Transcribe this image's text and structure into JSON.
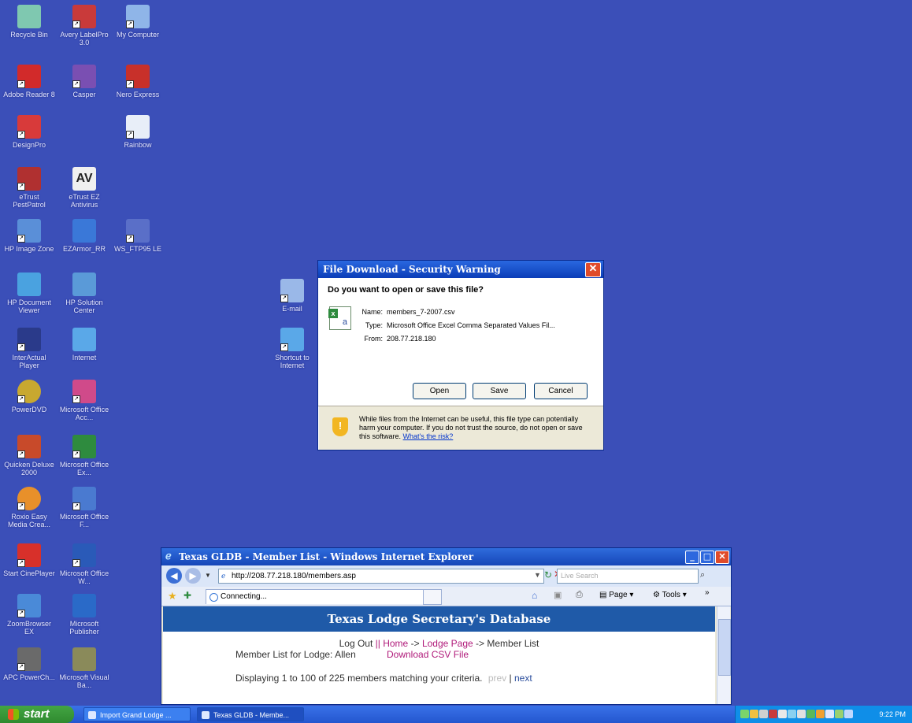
{
  "desktop": {
    "icons": [
      {
        "label": "Recycle Bin",
        "color": "#7fc8b0"
      },
      {
        "label": "Avery LabelPro 3.0",
        "color": "#c93a3a"
      },
      {
        "label": "My Computer",
        "color": "#8fb5e8"
      },
      {
        "label": "Adobe Reader 8",
        "color": "#d22a2a"
      },
      {
        "label": "Casper",
        "color": "#7a4fb2"
      },
      {
        "label": "Nero Express",
        "color": "#c8302a"
      },
      {
        "label": "DesignPro",
        "color": "#d83a3a"
      },
      {
        "label": "Rainbow",
        "color": "#e8eef8"
      },
      {
        "label": "eTrust PestPatrol",
        "color": "#b03030"
      },
      {
        "label": "eTrust EZ Antivirus",
        "color": "#f0f0f0"
      },
      {
        "label": "HP Image Zone",
        "color": "#5a8fd8"
      },
      {
        "label": "EZArmor_RR",
        "color": "#3a78d8"
      },
      {
        "label": "WS_FTP95 LE",
        "color": "#5a6fc8"
      },
      {
        "label": "HP Document Viewer",
        "color": "#4aa2e0"
      },
      {
        "label": "HP Solution Center",
        "color": "#5a9ad8"
      },
      {
        "label": "E-mail",
        "color": "#9ab8e8"
      },
      {
        "label": "InterActual Player",
        "color": "#2a3a8a"
      },
      {
        "label": "Internet",
        "color": "#5aa8e8"
      },
      {
        "label": "Shortcut to Internet",
        "color": "#5aa8e8"
      },
      {
        "label": "PowerDVD",
        "color": "#c8a830"
      },
      {
        "label": "Microsoft Office Acc...",
        "color": "#d04a8a"
      },
      {
        "label": "Quicken Deluxe 2000",
        "color": "#c84a2a"
      },
      {
        "label": "Microsoft Office Ex...",
        "color": "#2e8b3e"
      },
      {
        "label": "Roxio Easy Media Crea...",
        "color": "#e8902a"
      },
      {
        "label": "Microsoft Office F...",
        "color": "#4a7ad0"
      },
      {
        "label": "Start CinePlayer",
        "color": "#d8302a"
      },
      {
        "label": "Microsoft Office W...",
        "color": "#2a5ab8"
      },
      {
        "label": "ZoomBrowser EX",
        "color": "#4a8ad8"
      },
      {
        "label": "Microsoft Publisher",
        "color": "#2a6ac8"
      },
      {
        "label": "APC PowerCh...",
        "color": "#6a6a6a"
      },
      {
        "label": "Microsoft Visual Ba...",
        "color": "#8a8a5a"
      }
    ]
  },
  "dialog": {
    "title": "File Download - Security Warning",
    "close_glyph": "✕",
    "question": "Do you want to open or save this file?",
    "name_label": "Name:",
    "name_value": "members_7-2007.csv",
    "type_label": "Type:",
    "type_value": "Microsoft Office Excel Comma Separated Values Fil...",
    "from_label": "From:",
    "from_value": "208.77.218.180",
    "open_label": "Open",
    "save_label": "Save",
    "cancel_label": "Cancel",
    "warning_text": "While files from the Internet can be useful, this file type can potentially harm your computer. If you do not trust the source, do not open or save this software.",
    "risk_link": "What's the risk?"
  },
  "browser": {
    "title": "Texas GLDB - Member List - Windows Internet Explorer",
    "url": "http://208.77.218.180/members.asp",
    "search_placeholder": "Live Search",
    "tab_label": "Connecting...",
    "toolbar_page": "Page",
    "toolbar_tools": "Tools",
    "banner": "Texas Lodge Secretary's Database",
    "nav": {
      "logout": "Log Out",
      "sep": "||",
      "home": "Home",
      "arrow1": "->",
      "lodge": "Lodge Page",
      "arrow2": "->",
      "current": "Member List"
    },
    "member_list_label": "Member List for Lodge: Allen",
    "download_link": "Download CSV File",
    "displaying": "Displaying 1 to 100 of 225 members matching your criteria.",
    "prev": "prev",
    "pipe": "|",
    "next": "next"
  },
  "taskbar": {
    "start_label": "start",
    "items": [
      "Import Grand Lodge ...",
      "Texas GLDB - Membe..."
    ],
    "clock": "9:22 PM"
  }
}
